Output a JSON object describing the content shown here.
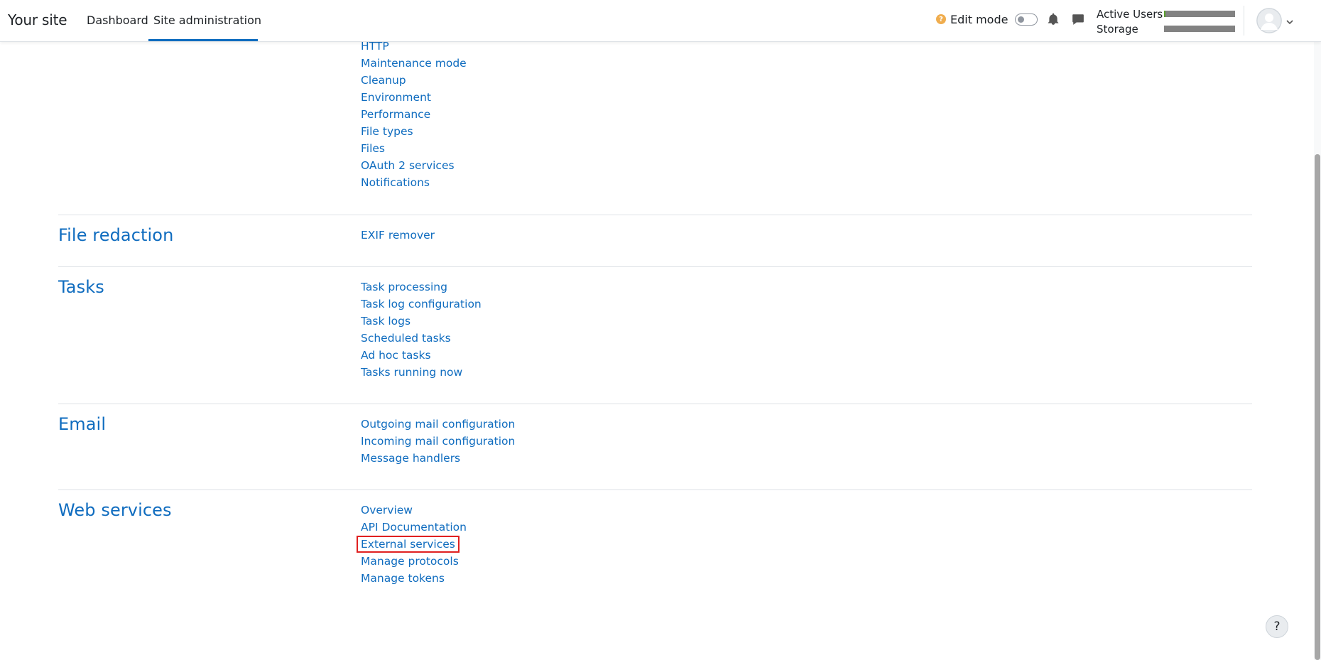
{
  "navbar": {
    "brand": "Your site",
    "links": [
      "Dashboard",
      "Site administration"
    ],
    "edit_mode": {
      "label": "Edit mode",
      "help_glyph": "?",
      "enabled": false
    },
    "usage": [
      {
        "label": "Active Users",
        "fill_fraction": 0.02
      },
      {
        "label": "Storage",
        "fill_fraction": 0.0
      }
    ],
    "icons": [
      "bell-icon",
      "chat-icon",
      "avatar",
      "chevron-down-icon"
    ]
  },
  "sections": [
    {
      "title": "",
      "links": [
        "HTTP",
        "Maintenance mode",
        "Cleanup",
        "Environment",
        "Performance",
        "File types",
        "Files",
        "OAuth 2 services",
        "Notifications"
      ]
    },
    {
      "title": "File redaction",
      "links": [
        "EXIF remover"
      ]
    },
    {
      "title": "Tasks",
      "links": [
        "Task processing",
        "Task log configuration",
        "Task logs",
        "Scheduled tasks",
        "Ad hoc tasks",
        "Tasks running now"
      ]
    },
    {
      "title": "Email",
      "links": [
        "Outgoing mail configuration",
        "Incoming mail configuration",
        "Message handlers"
      ]
    },
    {
      "title": "Web services",
      "links": [
        "Overview",
        "API Documentation",
        "External services",
        "Manage protocols",
        "Manage tokens"
      ],
      "highlighted_link": "External services"
    }
  ],
  "help_button": {
    "label": "?"
  },
  "colors": {
    "link": "#0f6cbf",
    "highlight_border": "#e02020",
    "usage_bar": "#828282",
    "usage_fill": "#5aa02c",
    "edit_help": "#f0ad4e"
  }
}
